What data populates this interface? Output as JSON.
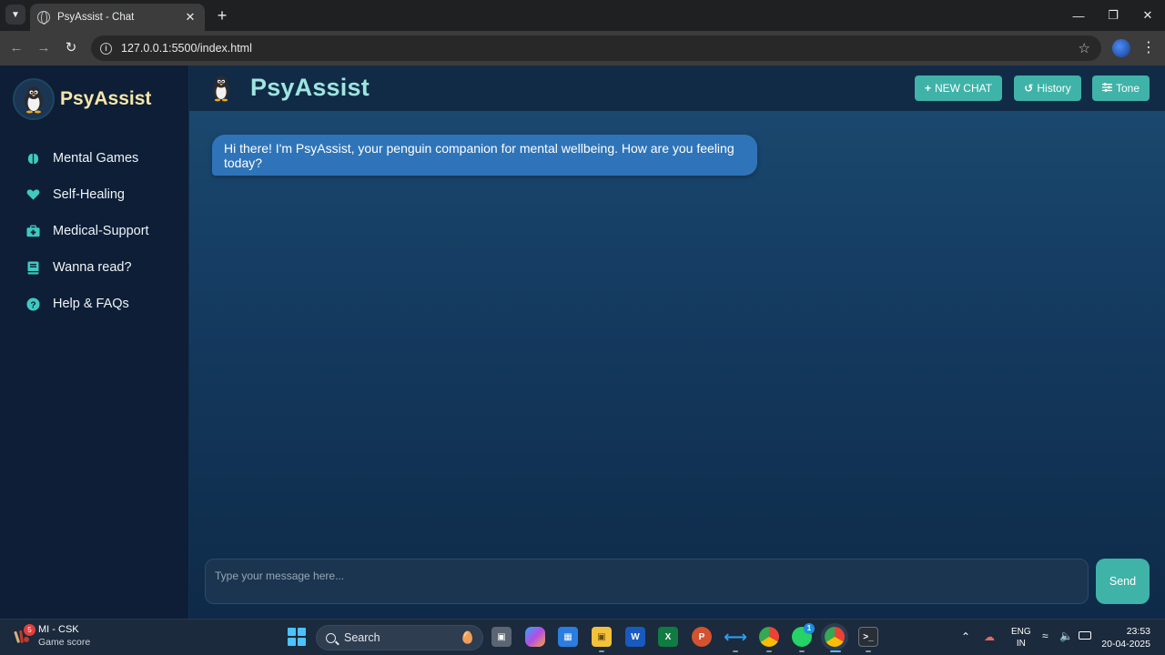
{
  "browser": {
    "tab_title": "PsyAssist - Chat",
    "url": "127.0.0.1:5500/index.html"
  },
  "sidebar": {
    "brand": "PsyAssist",
    "items": [
      {
        "label": "Mental Games",
        "icon": "brain-icon"
      },
      {
        "label": "Self-Healing",
        "icon": "heart-icon"
      },
      {
        "label": "Medical-Support",
        "icon": "medical-kit-icon"
      },
      {
        "label": "Wanna read?",
        "icon": "book-icon"
      },
      {
        "label": "Help & FAQs",
        "icon": "question-circle-icon"
      }
    ]
  },
  "header": {
    "title": "PsyAssist",
    "new_chat": "NEW CHAT",
    "history": "History",
    "tone": "Tone"
  },
  "chat": {
    "messages": [
      {
        "role": "bot",
        "text": "Hi there! I'm PsyAssist, your penguin companion for mental wellbeing. How are you feeling today?"
      }
    ],
    "input_placeholder": "Type your message here...",
    "send_label": "Send"
  },
  "taskbar": {
    "widget_title": "MI - CSK",
    "widget_subtitle": "Game score",
    "widget_badge": "5",
    "search_label": "Search",
    "whatsapp_badge": "1",
    "language": "ENG",
    "region": "IN",
    "time": "23:53",
    "date": "20-04-2025"
  },
  "colors": {
    "accent": "#3fb3a8",
    "brand_text": "#f7e6a8",
    "header_title": "#9ee5e0",
    "bot_bubble": "#2f74b8",
    "icon_teal": "#3fc9c0"
  }
}
